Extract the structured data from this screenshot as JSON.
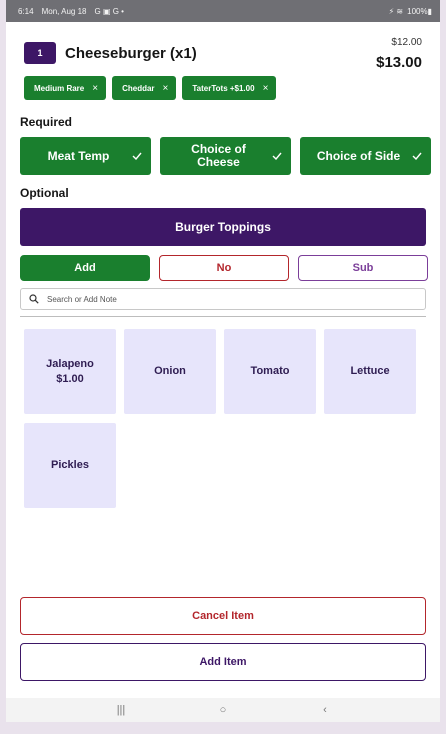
{
  "status_bar": {
    "time": "6:14",
    "date": "Mon, Aug 18",
    "notification_icons": "G ▣ G •",
    "system_icons": "⚡ ≋",
    "battery": "100%▮"
  },
  "item": {
    "quantity": "1",
    "title": "Cheeseburger (x1)",
    "original_price": "$12.00",
    "total_price": "$13.00"
  },
  "selected_modifiers": [
    {
      "label": "Medium Rare"
    },
    {
      "label": "Cheddar"
    },
    {
      "label": "TaterTots +$1.00"
    }
  ],
  "chip_remove_glyph": "×",
  "required": {
    "label": "Required",
    "options": [
      {
        "label": "Meat Temp"
      },
      {
        "label": "Choice of Cheese"
      },
      {
        "label": "Choice of Side"
      }
    ]
  },
  "optional": {
    "label": "Optional",
    "category": "Burger Toppings"
  },
  "actions": {
    "add": "Add",
    "no": "No",
    "sub": "Sub"
  },
  "search": {
    "placeholder": "Search or Add Note"
  },
  "toppings": [
    {
      "name": "Jalapeno",
      "price": "$1.00"
    },
    {
      "name": "Onion",
      "price": ""
    },
    {
      "name": "Tomato",
      "price": ""
    },
    {
      "name": "Lettuce",
      "price": ""
    },
    {
      "name": "Pickles",
      "price": ""
    }
  ],
  "footer": {
    "cancel": "Cancel Item",
    "add_item": "Add Item"
  },
  "nav": {
    "recents": "|||",
    "home": "○",
    "back": "‹"
  },
  "colors": {
    "primary_purple": "#3d1766",
    "green": "#1a7f2e",
    "red": "#b3262c",
    "sub_purple": "#7b3e99",
    "tile_bg": "#e7e5fb"
  }
}
